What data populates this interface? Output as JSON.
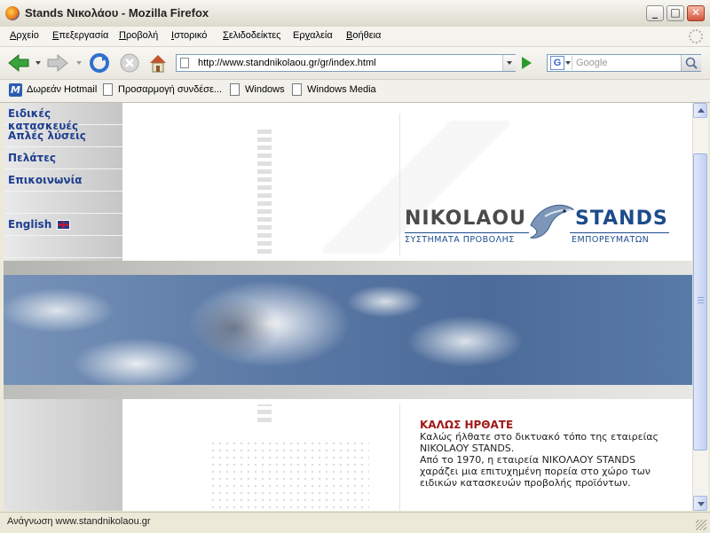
{
  "window": {
    "title": "Stands Νικολάου - Mozilla Firefox",
    "controls": {
      "minimize": "_",
      "maximize": "□",
      "close": "✕"
    }
  },
  "menu": {
    "items": [
      {
        "label": "Αρχείο",
        "underline": "Α",
        "rest": "ρχείο"
      },
      {
        "label": "Επεξεργασία",
        "underline": "Ε",
        "rest": "πεξεργασία"
      },
      {
        "label": "Προβολή",
        "underline": "Π",
        "rest": "ροβολή"
      },
      {
        "label": "Ιστορικό",
        "underline": "Ι",
        "rest": "στορικό"
      },
      {
        "label": "Σελιδοδείκτες",
        "underline": "Σ",
        "rest": "ελιδοδείκτες"
      },
      {
        "label": "Εργαλεία",
        "pre": "Ερ",
        "underline": "γ",
        "rest": "αλεία"
      },
      {
        "label": "Βοήθεια",
        "underline": "Β",
        "rest": "οήθεια"
      }
    ]
  },
  "navigation": {
    "url": "http://www.standnikolaou.gr/gr/index.html",
    "search_placeholder": "Google",
    "search_engine_letter": "G",
    "icons": [
      "back-arrow-icon",
      "forward-arrow-icon",
      "reload-icon",
      "stop-icon",
      "home-icon",
      "go-arrow-icon",
      "magnifier-icon"
    ]
  },
  "bookmarks": [
    {
      "label": "Δωρεάν Hotmail",
      "icon": "M"
    },
    {
      "label": "Προσαρμογή συνδέσε..."
    },
    {
      "label": "Windows"
    },
    {
      "label": "Windows Media"
    }
  ],
  "page": {
    "nav_links": [
      "Ειδικές κατασκευές",
      "Απλές λύσεις",
      "Πελάτες",
      "Επικοινωνία"
    ],
    "language_link": "English",
    "logo": {
      "left_word": "NIKOLAOU",
      "right_word": "STANDS",
      "left_sub": "ΣΥΣΤΗΜΑΤΑ ΠΡΟΒΟΛΗΣ",
      "right_sub": "ΕΜΠΟΡΕΥΜΑΤΩΝ"
    },
    "welcome": {
      "title": "ΚΑΛΩΣ ΗΡΘΑΤΕ",
      "lines": [
        "Καλώς ήλθατε στο δικτυακό τόπο της εταιρείας",
        "NIKOLAOY STANDS.",
        "Από το 1970, η εταιρεία ΝΙΚΟΛΑΟΥ STANDS",
        "χαράζει μια επιτυχημένη πορεία στο χώρο των",
        "ειδικών κατασκευών προβολής προϊόντων."
      ]
    }
  },
  "status": {
    "text": "Ανάγνωση www.standnikolaou.gr"
  },
  "colors": {
    "nav_link": "#1f3f8f",
    "welcome_title": "#a01818",
    "logo_blue": "#1c4b8c",
    "logo_grey": "#4a4a4a"
  }
}
